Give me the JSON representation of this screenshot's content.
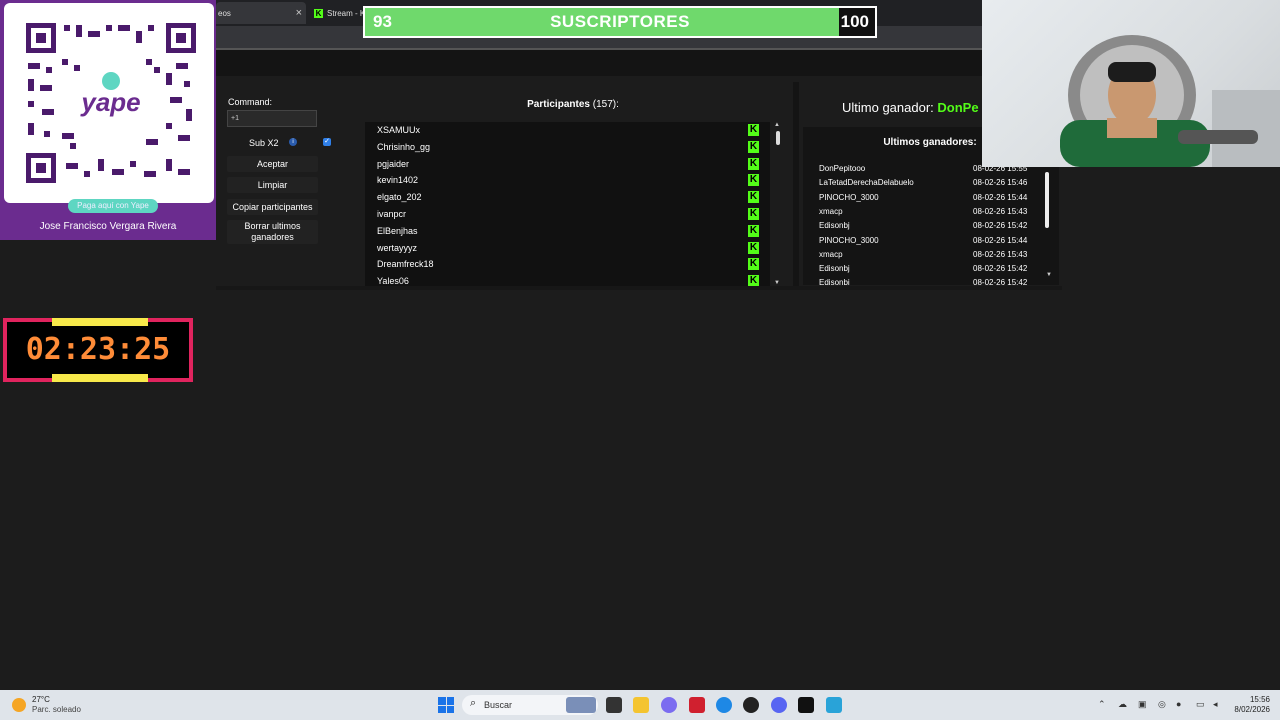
{
  "browser": {
    "tab1_label": "eos",
    "tab1_close": "×",
    "tab2_label": "Stream - Ki"
  },
  "subscribers": {
    "current": "93",
    "label": "SUSCRIPTORES",
    "goal": "100",
    "progress": 0.93
  },
  "qr_panel": {
    "pay_label": "Paga aquí con Yape",
    "owner_name": "Jose Francisco Vergara Rivera"
  },
  "timer": {
    "value": "02:23:25"
  },
  "controls": {
    "command_label": "Command:",
    "command_value": "+1",
    "subx2_label": "Sub X2",
    "accept_label": "Aceptar",
    "clear_label": "Limpiar",
    "copy_label": "Copiar participantes",
    "delete_label": "Borrar ultimos ganadores"
  },
  "participants": {
    "title": "Participantes",
    "count": "(157):",
    "items": [
      "XSAMUUx",
      "Chrisinho_gg",
      "pgjaider",
      "kevin1402",
      "elgato_202",
      "ivanpcr",
      "ElBenjhas",
      "wertayyyz",
      "Dreamfreck18",
      "Yales06"
    ]
  },
  "winners": {
    "last_label": "Ultimo ganador:",
    "last_name": "DonPe",
    "title": "Ultimos ganadores:",
    "items": [
      {
        "name": "DonPepitooo",
        "date": "08-02-26 15:55"
      },
      {
        "name": "LaTetadDerechaDelabuelo",
        "date": "08-02-26 15:46"
      },
      {
        "name": "PINOCHO_3000",
        "date": "08-02-26 15:44"
      },
      {
        "name": "xmacp",
        "date": "08-02-26 15:43"
      },
      {
        "name": "Edisonbj",
        "date": "08-02-26 15:42"
      },
      {
        "name": "PINOCHO_3000",
        "date": "08-02-26 15:44"
      },
      {
        "name": "xmacp",
        "date": "08-02-26 15:43"
      },
      {
        "name": "Edisonbj",
        "date": "08-02-26 15:42"
      },
      {
        "name": "Edisonbj",
        "date": "08-02-26 15:42"
      }
    ]
  },
  "taskbar": {
    "weather_temp": "27°C",
    "weather_desc": "Parc. soleado",
    "search_label": "Buscar",
    "time": "15:56",
    "date": "8/02/2026"
  },
  "colors": {
    "kick_green": "#53fc18",
    "progress_green": "#6fd96c",
    "qr_purple": "#6b2c8f",
    "timer_border": "#e0245e",
    "timer_text": "#ff8c38"
  }
}
